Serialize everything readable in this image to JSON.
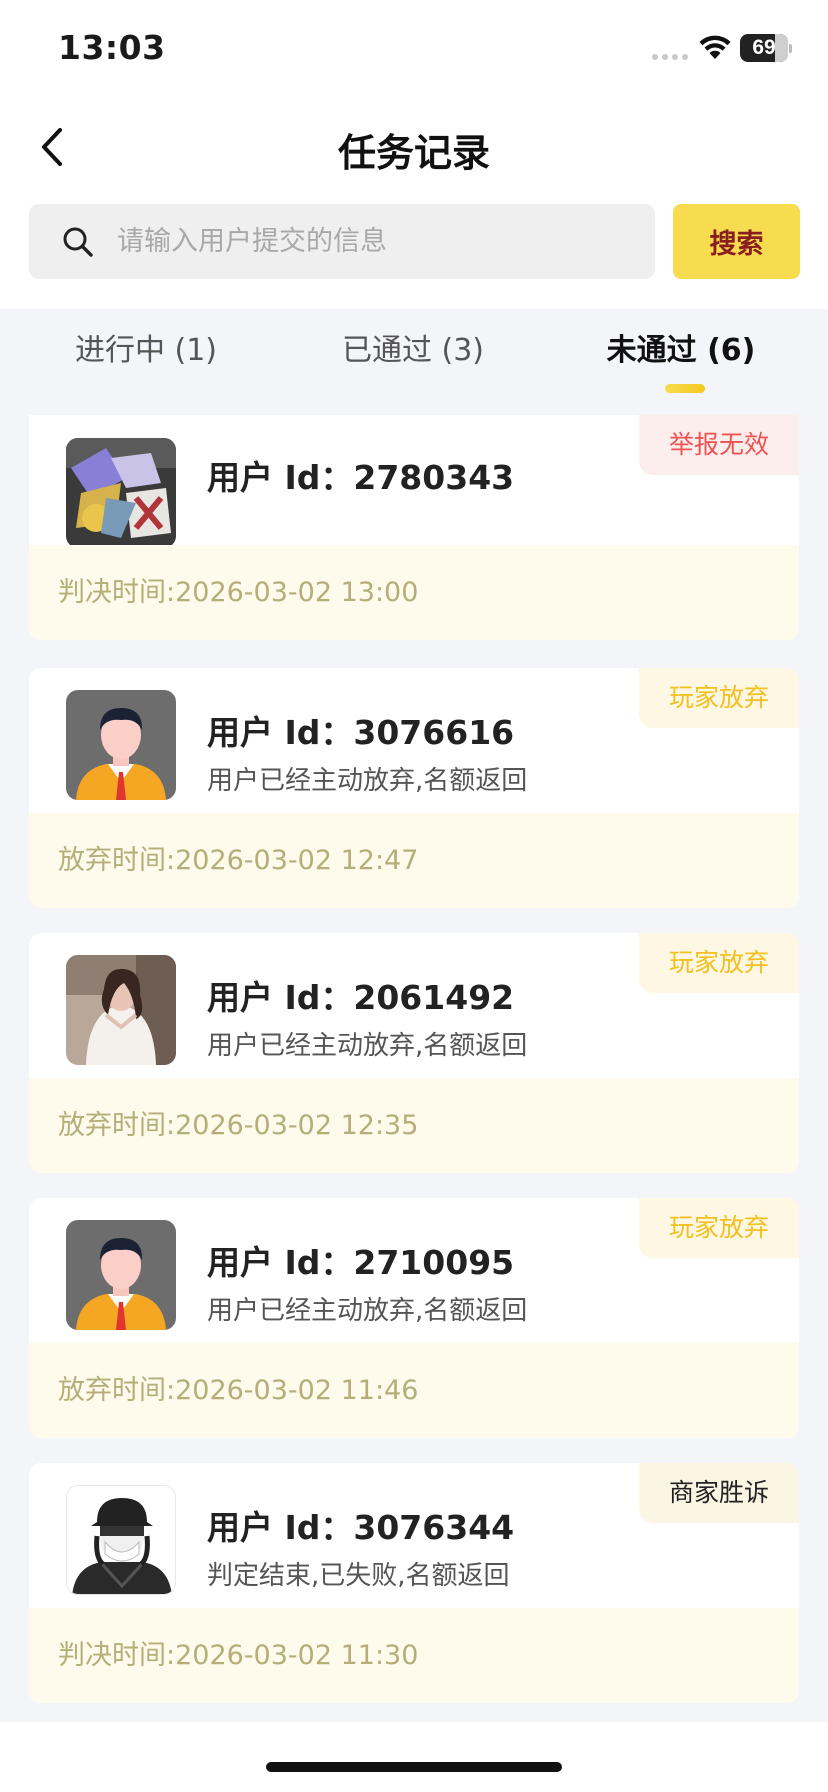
{
  "status_bar": {
    "time": "13:03",
    "battery": "69"
  },
  "nav": {
    "title": "任务记录"
  },
  "search": {
    "placeholder": "请输入用户提交的信息",
    "value": "",
    "button_label": "搜索"
  },
  "tabs": [
    {
      "label": "进行中 (1)"
    },
    {
      "label": "已通过 (3)"
    },
    {
      "label": "未通过 (6)",
      "active": true
    }
  ],
  "records": [
    {
      "user_id": "用户 Id：2780343",
      "note": "",
      "status": "举报无效",
      "time": "判决时间:2026-03-02 13:00",
      "avatar": "game-items-avatar"
    },
    {
      "user_id": "用户 Id：3076616",
      "note": "用户已经主动放弃,名额返回",
      "status": "玩家放弃",
      "time": "放弃时间:2026-03-02 12:47",
      "avatar": "default-man-avatar"
    },
    {
      "user_id": "用户 Id：2061492",
      "note": "用户已经主动放弃,名额返回",
      "status": "玩家放弃",
      "time": "放弃时间:2026-03-02 12:35",
      "avatar": "photo-woman-avatar"
    },
    {
      "user_id": "用户 Id：2710095",
      "note": "用户已经主动放弃,名额返回",
      "status": "玩家放弃",
      "time": "放弃时间:2026-03-02 11:46",
      "avatar": "default-man-avatar"
    },
    {
      "user_id": "用户 Id：3076344",
      "note": "判定结束,已失败,名额返回",
      "status": "商家胜诉",
      "time": "判决时间:2026-03-02 11:30",
      "avatar": "masked-person-avatar"
    }
  ],
  "colors": {
    "accent": "#f7dc4f",
    "search_text": "#8a1e1e",
    "invalid": "#f05151",
    "quit": "#f3c020",
    "footer_text": "#b5ae78"
  }
}
